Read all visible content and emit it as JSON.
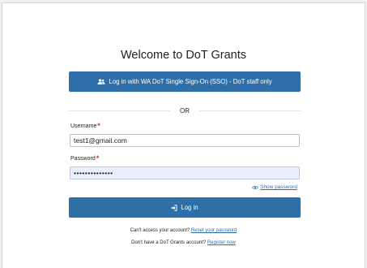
{
  "page": {
    "title": "Welcome to DoT Grants"
  },
  "sso_button": {
    "label": "Log in with WA DoT Single Sign-On (SSO) - DoT staff only",
    "icon": "users-icon"
  },
  "divider": {
    "text": "OR"
  },
  "form": {
    "username_label": "Username",
    "username_value": "test1@gmail.com",
    "password_label": "Password",
    "password_value": "••••••••••••••",
    "required_mark": "*",
    "show_password": "Show password"
  },
  "login_button": {
    "label": "Log in",
    "icon": "sign-in-icon"
  },
  "footer": {
    "access_text": "Can't access your account?",
    "reset_link": "Reset your password",
    "account_text": "Don't have a DoT Grants account?",
    "register_link": "Register now"
  },
  "colors": {
    "primary": "#2f6fa9",
    "required": "#c0392b",
    "autofill": "#e8f0fe"
  }
}
